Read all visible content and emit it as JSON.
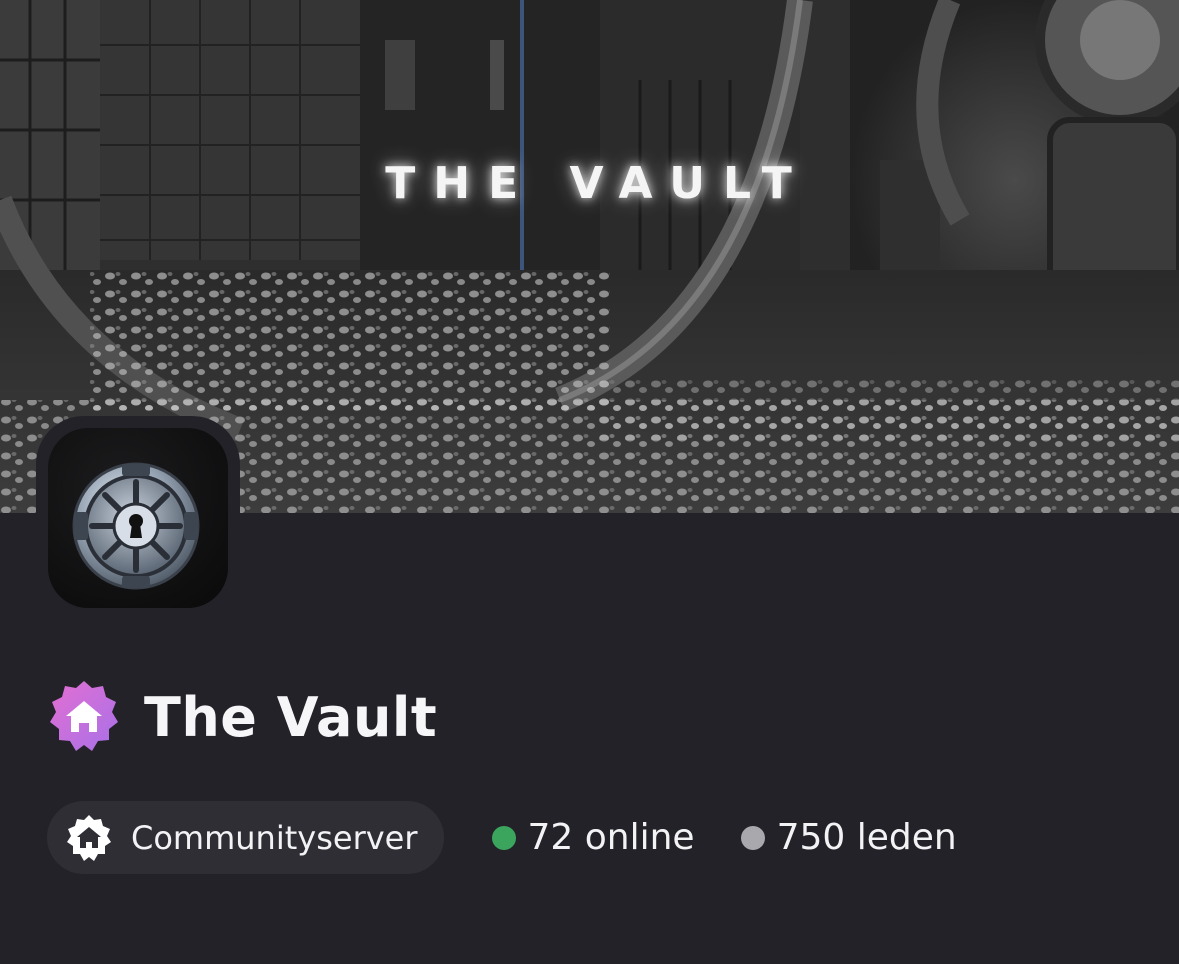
{
  "banner": {
    "title": "THE VAULT"
  },
  "server": {
    "name": "The Vault",
    "type_label": "Communityserver",
    "online": "72 online",
    "members": "750 leden"
  },
  "icons": {
    "badge": "home-icon",
    "type": "home-icon"
  },
  "colors": {
    "background": "#232228",
    "pill": "#2f2e35",
    "online_dot": "#3ba55d",
    "members_dot": "#a8a8ad",
    "badge_gradient_start": "#e46fd2",
    "badge_gradient_end": "#a770e8"
  }
}
